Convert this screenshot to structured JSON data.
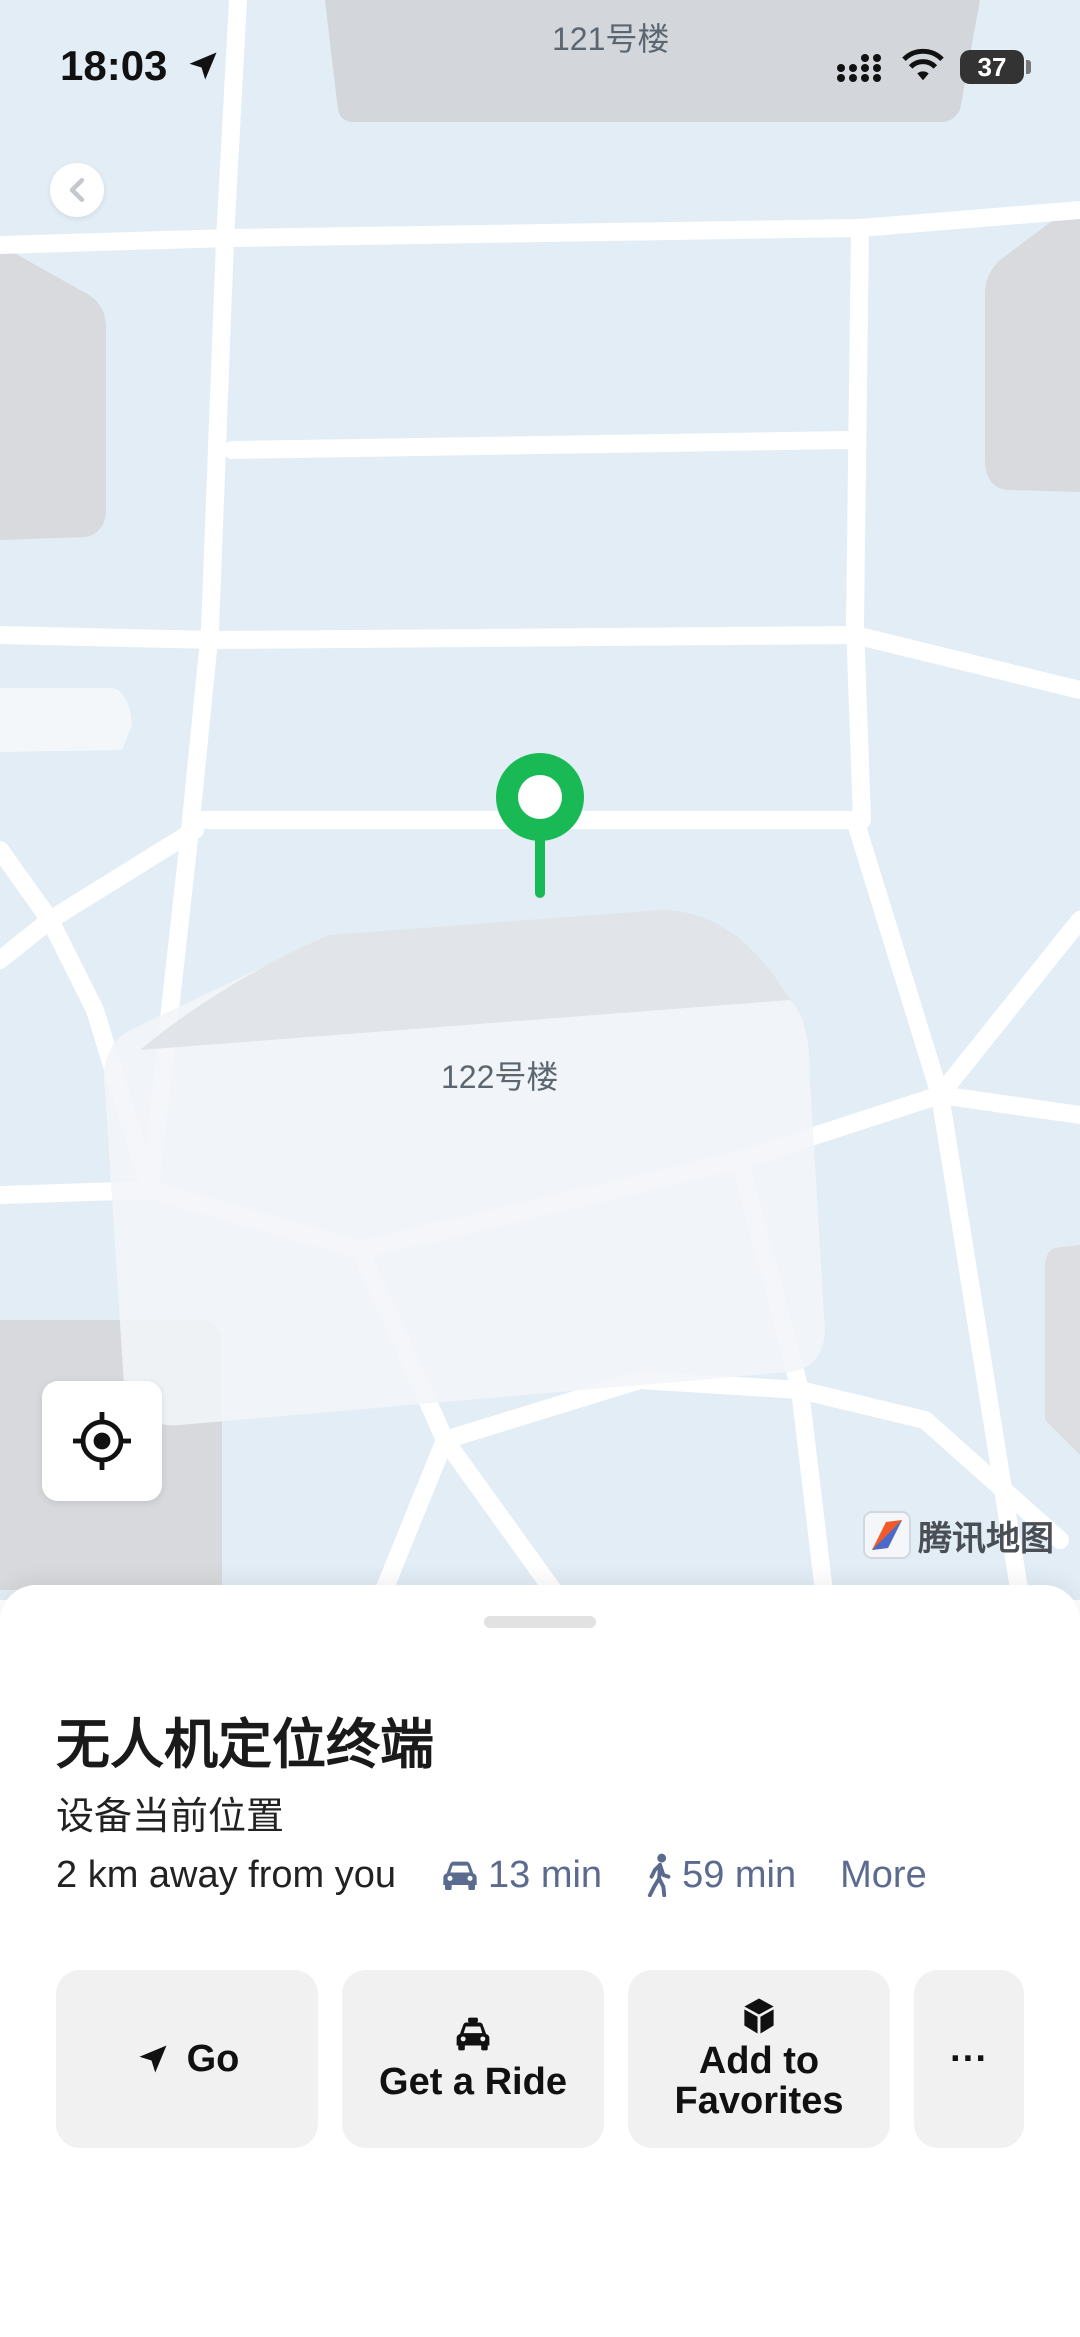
{
  "status_bar": {
    "time": "18:03",
    "battery": "37"
  },
  "map": {
    "labels": {
      "top_building": "121号楼",
      "main_building": "122号楼"
    },
    "provider": "腾讯地图",
    "pin_color": "#19b955"
  },
  "sheet": {
    "title": "无人机定位终端",
    "subtitle": "设备当前位置",
    "distance": "2 km away from you",
    "drive_time": "13 min",
    "walk_time": "59 min",
    "more_label": "More",
    "accent_color": "#5b6b8f",
    "buttons": {
      "go": "Go",
      "ride": "Get a Ride",
      "favorites_line1": "Add to",
      "favorites_line2": "Favorites",
      "more": "···"
    }
  },
  "icons": [
    "location-arrow-icon",
    "signal-icon",
    "wifi-icon",
    "battery-icon",
    "back-chevron-icon",
    "locate-icon",
    "tencent-map-logo-icon",
    "map-pin-icon",
    "car-icon",
    "walk-icon",
    "navigate-icon",
    "taxi-icon",
    "cube-icon",
    "ellipsis-icon"
  ]
}
